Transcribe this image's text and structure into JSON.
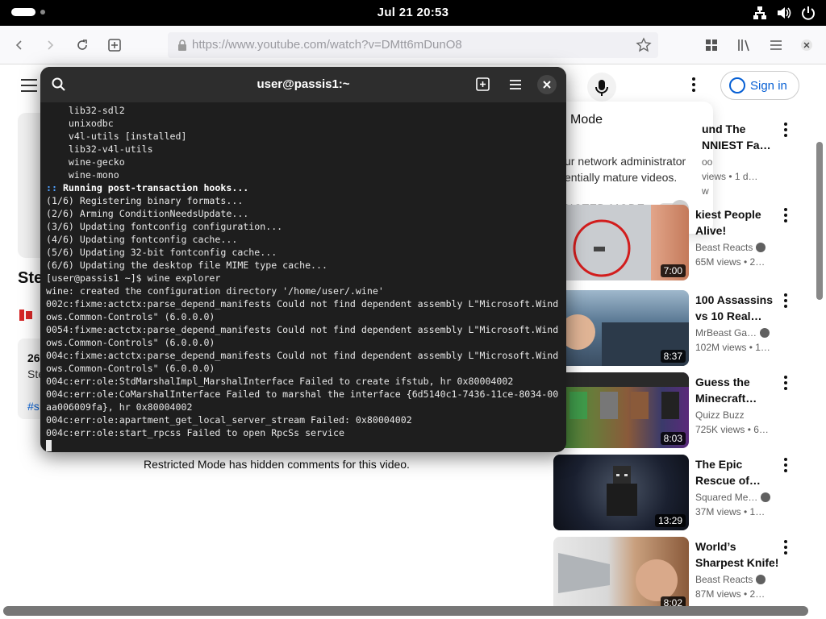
{
  "topbar": {
    "clock": "Jul 21  20:53"
  },
  "browser": {
    "url": "https://www.youtube.com/watch?v=DMtt6mDunO8"
  },
  "youtube": {
    "signin_label": "Sign in",
    "video_title_partial": "Ste",
    "desc_number_partial": "26",
    "desc_sub_partial": "Ste",
    "desc_hashtag_partial": "#s",
    "restricted_notice": "Restricted Mode has hidden comments for this video.",
    "popup": {
      "title": "Mode",
      "desc_line1": "ur network administrator",
      "desc_line2": "entially mature videos.",
      "toggle_label": "RICTED MODE"
    },
    "sidebar": [
      {
        "title": "und The NNIEST Fa…",
        "channel": "oo",
        "views": "views • 1 d…",
        "extra": "w",
        "duration": ""
      },
      {
        "title": "kiest People Alive!",
        "channel": "Beast Reacts",
        "views": "65M views • 2…",
        "duration": "7:00",
        "thumb_color": "#b7bcc4"
      },
      {
        "title": "100 Assassins vs 10 Real…",
        "channel": "MrBeast Ga…",
        "views": "102M views • 1…",
        "duration": "8:37",
        "thumb_color": "#6b8ca8"
      },
      {
        "title": "Guess the Minecraft…",
        "channel": "Quizz Buzz",
        "views": "725K views • 6…",
        "duration": "8:03",
        "thumb_color": "#6a7a3a"
      },
      {
        "title": "The Epic Rescue of…",
        "channel": "Squared Me…",
        "views": "37M views • 1…",
        "duration": "13:29",
        "thumb_color": "#1a2030"
      },
      {
        "title": "World’s Sharpest Knife!",
        "channel": "Beast Reacts",
        "views": "87M views • 2…",
        "duration": "8:02",
        "thumb_color": "#c4a890"
      }
    ]
  },
  "terminal": {
    "title": "user@passis1:~",
    "lines": [
      "    lib32-sdl2",
      "    unixodbc",
      "    v4l-utils [installed]",
      "    lib32-v4l-utils",
      "    wine-gecko",
      "    wine-mono",
      "(1/6) Registering binary formats...",
      "(2/6) Arming ConditionNeedsUpdate...",
      "(3/6) Updating fontconfig configuration...",
      "(4/6) Updating fontconfig cache...",
      "(5/6) Updating 32-bit fontconfig cache...",
      "(6/6) Updating the desktop file MIME type cache...",
      "[user@passis1 ~]$ wine explorer",
      "wine: created the configuration directory '/home/user/.wine'",
      "002c:fixme:actctx:parse_depend_manifests Could not find dependent assembly L\"Microsoft.Wind",
      "ows.Common-Controls\" (6.0.0.0)",
      "0054:fixme:actctx:parse_depend_manifests Could not find dependent assembly L\"Microsoft.Wind",
      "ows.Common-Controls\" (6.0.0.0)",
      "004c:fixme:actctx:parse_depend_manifests Could not find dependent assembly L\"Microsoft.Wind",
      "ows.Common-Controls\" (6.0.0.0)",
      "004c:err:ole:StdMarshalImpl_MarshalInterface Failed to create ifstub, hr 0x80004002",
      "004c:err:ole:CoMarshalInterface Failed to marshal the interface {6d5140c1-7436-11ce-8034-00",
      "aa006009fa}, hr 0x80004002",
      "004c:err:ole:apartment_get_local_server_stream Failed: 0x80004002",
      "004c:err:ole:start_rpcss Failed to open RpcSs service"
    ],
    "hook_prefix": "::",
    "hook_text": " Running post-transaction hooks..."
  }
}
